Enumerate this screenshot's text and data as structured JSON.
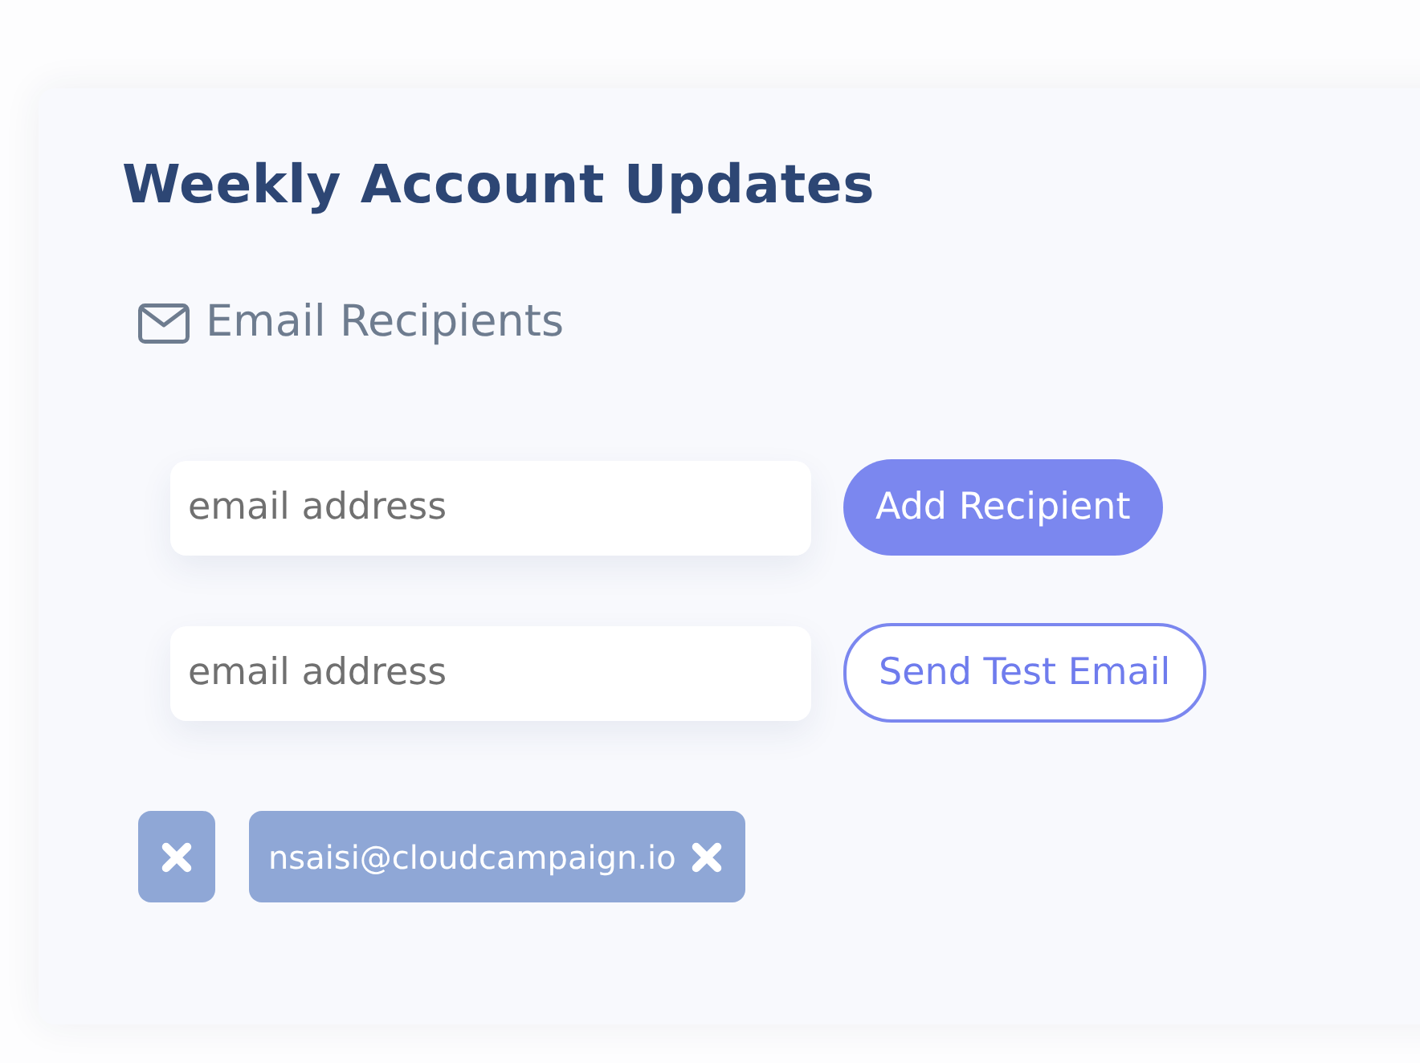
{
  "card": {
    "title": "Weekly Account Updates",
    "section": {
      "label": "Email Recipients"
    }
  },
  "rows": [
    {
      "field": {
        "placeholder": "email address"
      },
      "button": {
        "label": "Add Recipient",
        "kind": "primary"
      }
    },
    {
      "field": {
        "placeholder": "email address"
      },
      "button": {
        "label": "Send Test Email",
        "kind": "outline"
      }
    }
  ],
  "recipients": [
    {
      "kind": "blank"
    },
    {
      "kind": "email",
      "label": "nsaisi@cloudcampaign.io"
    }
  ]
}
